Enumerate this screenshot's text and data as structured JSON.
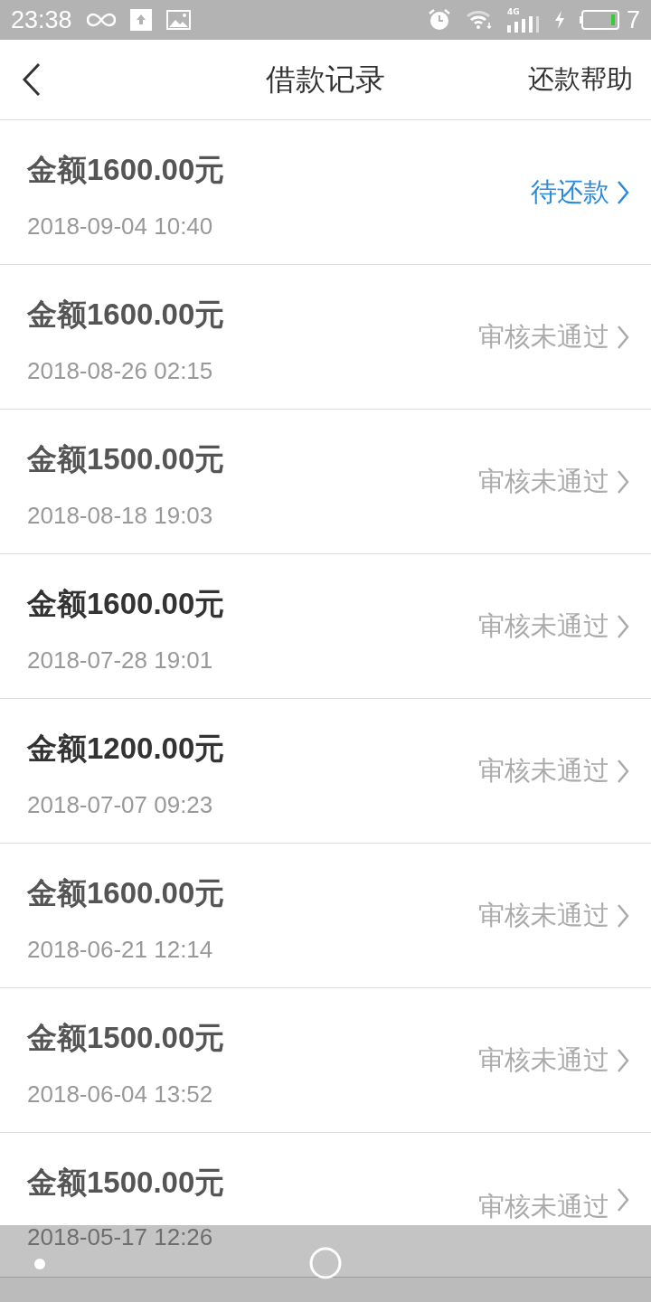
{
  "status_bar": {
    "time": "23:38",
    "network": "4G",
    "battery_text": "7"
  },
  "header": {
    "title": "借款记录",
    "action": "还款帮助"
  },
  "records": [
    {
      "amount": "金额1600.00元",
      "date": "2018-09-04 10:40",
      "status": "待还款",
      "kind": "pending",
      "emphasis": false
    },
    {
      "amount": "金额1600.00元",
      "date": "2018-08-26 02:15",
      "status": "审核未通过",
      "kind": "rejected",
      "emphasis": false
    },
    {
      "amount": "金额1500.00元",
      "date": "2018-08-18 19:03",
      "status": "审核未通过",
      "kind": "rejected",
      "emphasis": false
    },
    {
      "amount": "金额1600.00元",
      "date": "2018-07-28 19:01",
      "status": "审核未通过",
      "kind": "rejected",
      "emphasis": true
    },
    {
      "amount": "金额1200.00元",
      "date": "2018-07-07 09:23",
      "status": "审核未通过",
      "kind": "rejected",
      "emphasis": true
    },
    {
      "amount": "金额1600.00元",
      "date": "2018-06-21 12:14",
      "status": "审核未通过",
      "kind": "rejected",
      "emphasis": false
    },
    {
      "amount": "金额1500.00元",
      "date": "2018-06-04 13:52",
      "status": "审核未通过",
      "kind": "rejected",
      "emphasis": false
    },
    {
      "amount": "金额1500.00元",
      "date": "2018-05-17 12:26",
      "status": "审核未通过",
      "kind": "rejected",
      "emphasis": false
    }
  ]
}
